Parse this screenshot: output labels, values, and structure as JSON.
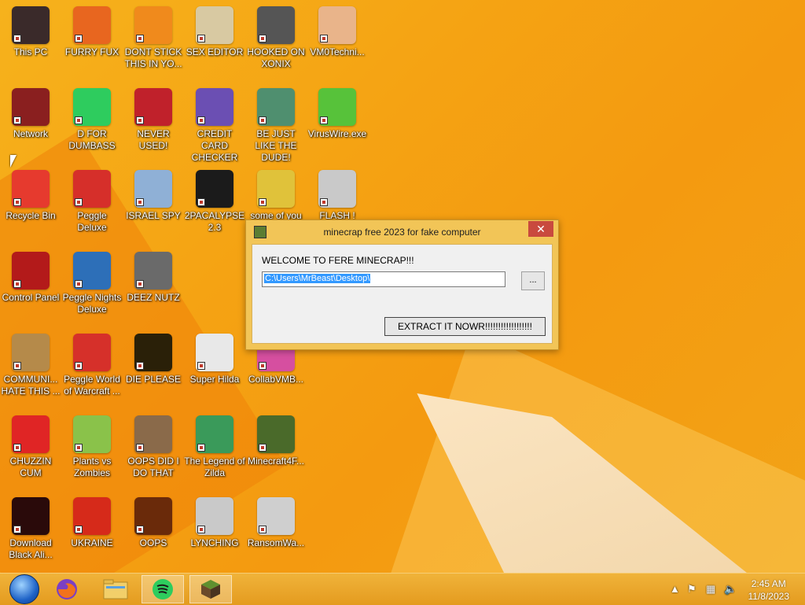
{
  "desktop": {
    "icons": [
      {
        "label": "This PC",
        "icon": "monitor-icon",
        "color": "#3a2a2a",
        "col": 0,
        "row": 0
      },
      {
        "label": "FURRY FUX",
        "icon": "firefox-icon",
        "color": "#e8661f",
        "col": 1,
        "row": 0
      },
      {
        "label": "DONT STICK THIS IN YO...",
        "icon": "traffic-cone-icon",
        "color": "#f08a1c",
        "col": 2,
        "row": 0
      },
      {
        "label": "SEX EDITOR",
        "icon": "hex-editor-icon",
        "color": "#d8c9a2",
        "col": 3,
        "row": 0
      },
      {
        "label": "HOOKED ON XONIX",
        "icon": "xonix-icon",
        "color": "#555555",
        "col": 4,
        "row": 0
      },
      {
        "label": "VM0Techni...",
        "icon": "doctor-icon",
        "color": "#e9b48a",
        "col": 5,
        "row": 0
      },
      {
        "label": "Network",
        "icon": "network-icon",
        "color": "#8a1f1f",
        "col": 0,
        "row": 1
      },
      {
        "label": "D FOR DUMBASS",
        "icon": "spotify-icon",
        "color": "#2ecc5e",
        "col": 1,
        "row": 1
      },
      {
        "label": "NEVER USED!",
        "icon": "devcpp-icon",
        "color": "#c0212b",
        "col": 2,
        "row": 1
      },
      {
        "label": "CREDIT CARD CHECKER",
        "icon": "credit-card-icon",
        "color": "#6b4fb3",
        "col": 3,
        "row": 1
      },
      {
        "label": "BE JUST LIKE THE DUDE!",
        "icon": "santa-icon",
        "color": "#4f8f6f",
        "col": 4,
        "row": 1
      },
      {
        "label": "VirusWire.exe",
        "icon": "limewire-icon",
        "color": "#57c23a",
        "col": 5,
        "row": 1
      },
      {
        "label": "Recycle Bin",
        "icon": "recycle-bin-icon",
        "color": "#e63a2e",
        "col": 0,
        "row": 2
      },
      {
        "label": "Peggle Deluxe",
        "icon": "peggle-icon",
        "color": "#d62f2a",
        "col": 1,
        "row": 2
      },
      {
        "label": "ISRAEL SPY",
        "icon": "spy-network-icon",
        "color": "#8fb0d6",
        "col": 2,
        "row": 2
      },
      {
        "label": "2PACALYPSE 2.3",
        "icon": "terminal-icon",
        "color": "#1b1b1b",
        "col": 3,
        "row": 2
      },
      {
        "label": "some of you",
        "icon": "bear-icon",
        "color": "#e0c23a",
        "col": 4,
        "row": 2
      },
      {
        "label": "FLASH !",
        "icon": "flash-icon",
        "color": "#c9c9c9",
        "col": 5,
        "row": 2
      },
      {
        "label": "Control Panel",
        "icon": "control-panel-icon",
        "color": "#b31a1a",
        "col": 0,
        "row": 3
      },
      {
        "label": "Peggle Nights Deluxe",
        "icon": "peggle-nights-icon",
        "color": "#2d6fb8",
        "col": 1,
        "row": 3
      },
      {
        "label": "DEEZ NUTZ",
        "icon": "folder-stack-icon",
        "color": "#6a6a6a",
        "col": 2,
        "row": 3
      },
      {
        "label": "COMMUNI... HATE THIS ...",
        "icon": "money-bag-icon",
        "color": "#b58a4a",
        "col": 0,
        "row": 4
      },
      {
        "label": "Peggle World of Warcraft ...",
        "icon": "peggle-wow-icon",
        "color": "#d6302a",
        "col": 1,
        "row": 4
      },
      {
        "label": "DIE PLEASE",
        "icon": "adobe-de-icon",
        "color": "#2a2008",
        "col": 2,
        "row": 4
      },
      {
        "label": "Super Hilda",
        "icon": "hilda-icon",
        "color": "#e8e8e8",
        "col": 3,
        "row": 4
      },
      {
        "label": "CollabVMB...",
        "icon": "collabvm-icon",
        "color": "#d64fa0",
        "col": 4,
        "row": 4
      },
      {
        "label": "CHUZZIN CUM",
        "icon": "chuzzle-icon",
        "color": "#e02525",
        "col": 0,
        "row": 5
      },
      {
        "label": "Plants vs Zombies",
        "icon": "pvz-icon",
        "color": "#8ac24a",
        "col": 1,
        "row": 5
      },
      {
        "label": "OOPS DID I DO THAT",
        "icon": "portrait-icon",
        "color": "#8a6a4a",
        "col": 2,
        "row": 5
      },
      {
        "label": "The Legend of Zilda",
        "icon": "zelda-icon",
        "color": "#3a9a5a",
        "col": 3,
        "row": 5
      },
      {
        "label": "Minecraft4F...",
        "icon": "minecraft-icon",
        "color": "#4a6a2a",
        "col": 4,
        "row": 5
      },
      {
        "label": "Download Black Ali...",
        "icon": "black-ali-icon",
        "color": "#2a0a0a",
        "col": 0,
        "row": 6
      },
      {
        "label": "UKRAINE",
        "icon": "radiation-icon",
        "color": "#d62a1a",
        "col": 1,
        "row": 6
      },
      {
        "label": "OOPS",
        "icon": "book-icon",
        "color": "#6a2a0a",
        "col": 2,
        "row": 6
      },
      {
        "label": "LYNCHING",
        "icon": "noose-icon",
        "color": "#c9c9c9",
        "col": 3,
        "row": 6
      },
      {
        "label": "RansomWa...",
        "icon": "skull-icon",
        "color": "#cfcfcf",
        "col": 4,
        "row": 6
      }
    ]
  },
  "dialog": {
    "title": "minecrap free 2023 for fake computer",
    "close_label": "✕",
    "welcome": "WELCOME TO FERE MINECRAP!!!",
    "path_value": "C:\\Users\\MrBeast\\Desktop\\",
    "browse_label": "...",
    "extract_label": "EXTRACT IT NOWR!!!!!!!!!!!!!!!!!!"
  },
  "taskbar": {
    "items": [
      {
        "name": "start-button",
        "icon": "start-orb-icon"
      },
      {
        "name": "taskbar-firefox",
        "icon": "firefox-icon"
      },
      {
        "name": "taskbar-file-explorer",
        "icon": "folder-icon"
      },
      {
        "name": "taskbar-spotify",
        "icon": "spotify-icon",
        "active": true
      },
      {
        "name": "taskbar-minecraft",
        "icon": "minecraft-icon",
        "active": true
      }
    ],
    "tray": [
      "chevron-up-icon",
      "flag-icon",
      "network-icon",
      "speaker-icon"
    ],
    "clock_time": "2:45 AM",
    "clock_date": "11/8/2023"
  }
}
